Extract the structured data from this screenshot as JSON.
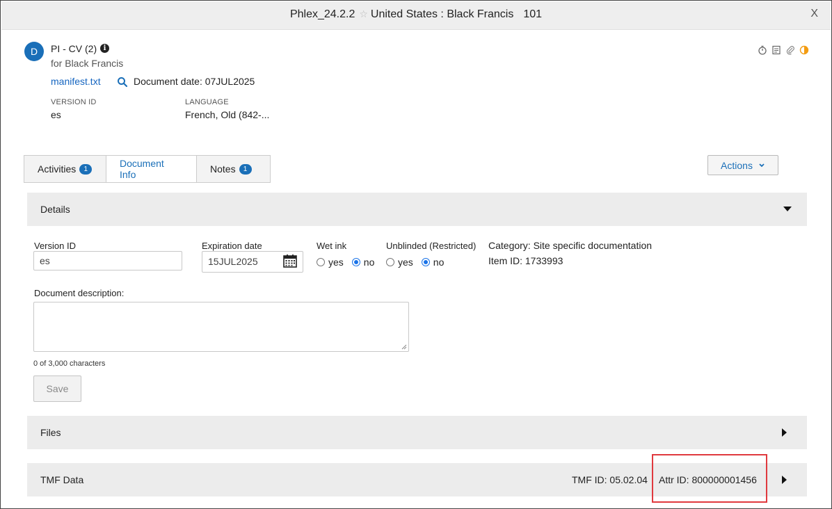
{
  "window": {
    "app": "Phlex_24.2.2",
    "star_icon": "star-icon",
    "context": "United States : Black Francis",
    "number": "101",
    "close_label": "X"
  },
  "header": {
    "avatar_letter": "D",
    "doc_title": "PI - CV (2)",
    "doc_subtitle": "for Black Francis",
    "file_link": "manifest.txt",
    "document_date": "Document date: 07JUL2025",
    "version_label": "VERSION ID",
    "version_value": "es",
    "language_label": "LANGUAGE",
    "language_value": "French, Old (842-...",
    "icons": [
      "timer-icon",
      "note-icon",
      "paperclip-icon",
      "half-circle-status-icon"
    ]
  },
  "tabs": [
    {
      "label": "Activities",
      "badge": "1",
      "active": false
    },
    {
      "label": "Document Info",
      "badge": "",
      "active": true
    },
    {
      "label": "Notes",
      "badge": "1",
      "active": false
    }
  ],
  "actions_label": "Actions",
  "details": {
    "section_label": "Details",
    "version_id_label": "Version ID",
    "version_id_value": "es",
    "expiration_label": "Expiration date",
    "expiration_value": "15JUL2025",
    "wet_ink_label": "Wet ink",
    "wet_ink_options": [
      "yes",
      "no"
    ],
    "wet_ink_selected": "no",
    "unblinded_label": "Unblinded (Restricted)",
    "unblinded_options": [
      "yes",
      "no"
    ],
    "unblinded_selected": "no",
    "category": "Category: Site specific documentation",
    "item_id": "Item ID: 1733993",
    "description_label": "Document description:",
    "description_value": "",
    "char_count": "0 of 3,000 characters",
    "save_label": "Save"
  },
  "files": {
    "section_label": "Files"
  },
  "tmf": {
    "section_label": "TMF Data",
    "tmf_id": "TMF ID: 05.02.04",
    "attr_id": "Attr ID: 800000001456"
  },
  "colors": {
    "accent": "#1a6fb8",
    "highlight_box": "#e0393e",
    "section_bg": "#ececec"
  }
}
